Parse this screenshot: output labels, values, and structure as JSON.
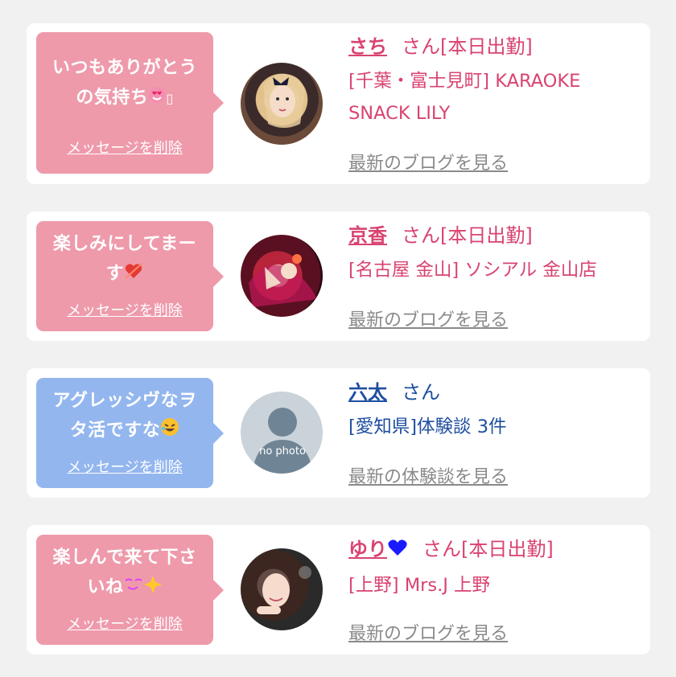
{
  "colors": {
    "pink_bubble": "#ee9aab",
    "blue_bubble": "#93b6ef",
    "pink_text": "#d94370",
    "blue_text": "#1f4fa0",
    "link_gray": "#8a8a8a",
    "background": "#f1f1f1"
  },
  "delete_label": "メッセージを削除",
  "cards": [
    {
      "message_line1": "いつもありがとう",
      "message_line2": "の気持ち",
      "message_emoji": "smiling-face-with-heart-eyes-icon",
      "name": "さち",
      "honorific": "さん[本日出勤]",
      "shop": "[千葉・富士見町] KARAOKE SNACK LILY",
      "link": "最新のブログを見る",
      "theme": "pink",
      "avatar": "photo-blonde-woman"
    },
    {
      "message_line1": "楽しみにしてまー",
      "message_line2": "す",
      "message_emoji": "heart-with-arrow-icon",
      "name": "京香",
      "honorific": "さん[本日出勤]",
      "shop": "[名古屋 金山] ソシアル 金山店",
      "link": "最新のブログを見る",
      "theme": "pink",
      "avatar": "photo-kimono-woman"
    },
    {
      "message_line1": "アグレッシヴなヲ",
      "message_line2": "タ活ですな",
      "message_emoji": "rolling-on-floor-laughing-icon",
      "name": "六太",
      "honorific": "さん",
      "shop": "[愛知県]体験談 3件",
      "link": "最新の体験談を見る",
      "theme": "blue",
      "avatar": "no-photo-placeholder",
      "no_photo_text": "no photo"
    },
    {
      "message_line1": "楽しんで来て下さ",
      "message_line2": "いね",
      "message_emoji": "smiling-face-sparkles-icon",
      "name": "ゆり",
      "name_emoji": "blue-heart-icon",
      "honorific": "さん[本日出勤]",
      "shop": "[上野] Mrs.J 上野",
      "link": "最新のブログを見る",
      "theme": "pink",
      "avatar": "photo-smiling-woman"
    }
  ]
}
